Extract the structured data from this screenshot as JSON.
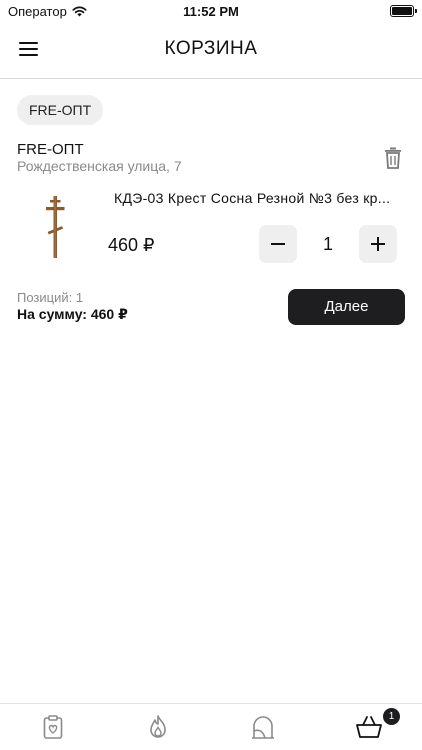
{
  "status_bar": {
    "carrier": "Оператор",
    "time": "11:52 PM"
  },
  "header": {
    "title": "КОРЗИНА"
  },
  "store_chip": {
    "label": "FRE-ОПТ"
  },
  "store": {
    "name": "FRE-ОПТ",
    "address": "Рождественская улица, 7"
  },
  "cart_items": [
    {
      "name": "КДЭ-03 Крест Сосна Резной №3 без кр...",
      "price": "460 ₽",
      "quantity": "1"
    }
  ],
  "summary": {
    "positions": "Позиций: 1",
    "total": "На сумму: 460 ₽"
  },
  "next_button": {
    "label": "Далее"
  },
  "tab_bar": {
    "tabs": [
      {
        "icon": "clipboard-heart-icon"
      },
      {
        "icon": "flame-icon"
      },
      {
        "icon": "ritual-icon"
      },
      {
        "icon": "basket-icon",
        "badge": "1"
      }
    ]
  },
  "colors": {
    "primary_dark": "#1e1e20",
    "chip_bg": "#efefef",
    "secondary_text": "#8a8a8a"
  }
}
